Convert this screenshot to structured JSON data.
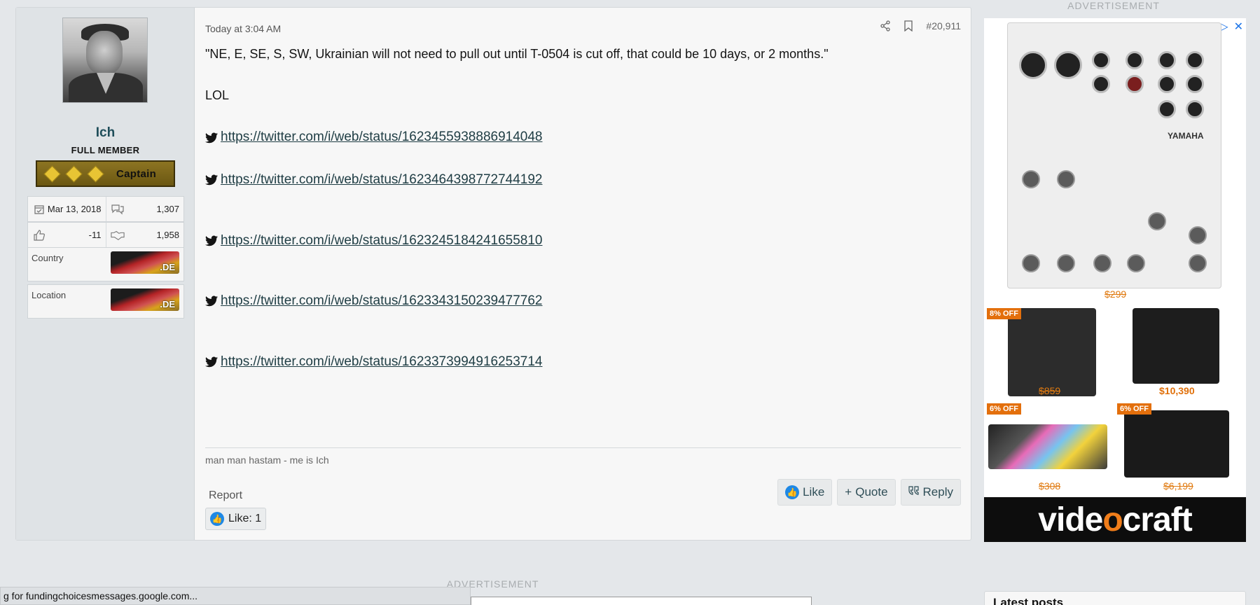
{
  "user": {
    "name": "Ich",
    "title": "FULL MEMBER",
    "rank": "Captain",
    "joined": "Mar 13, 2018",
    "messages": "1,307",
    "reaction_score": "-11",
    "points": "1,958",
    "country_label": "Country",
    "country_flag": ".DE",
    "location_label": "Location",
    "location_flag": ".DE"
  },
  "post": {
    "timestamp": "Today at 3:04 AM",
    "number": "#20,911",
    "quote": "\"NE, E, SE, S, SW, Ukrainian will not need to pull out until T-0504 is cut off, that could be 10 days, or 2 months.\"",
    "reply": "LOL",
    "links": [
      "https://twitter.com/i/web/status/1623455938886914048",
      "https://twitter.com/i/web/status/1623464398772744192",
      "https://twitter.com/i/web/status/1623245184241655810",
      "https://twitter.com/i/web/status/1623343150239477762",
      "https://twitter.com/i/web/status/1623373994916253714"
    ],
    "signature": "man man hastam - me is Ich",
    "report_label": "Report",
    "like_label": "Like",
    "quote_label": "Quote",
    "reply_label": "Reply",
    "likes_summary": "Like: 1"
  },
  "ads": {
    "label": "ADVERTISEMENT",
    "mixer_brand": "YAMAHA",
    "mixer_price": "$299",
    "recorder_badge": "8% OFF",
    "recorder_price": "$859",
    "camera_price": "$10,390",
    "keyboard_badge": "6% OFF",
    "keyboard_price": "$308",
    "sony_badge": "6% OFF",
    "sony_price": "$6,199",
    "brand": "videocraft",
    "brand_pre": "vide",
    "brand_o": "o",
    "brand_post": "craft"
  },
  "bottom": {
    "ad_label": "ADVERTISEMENT",
    "status_text": "g for fundingchoicesmessages.google.com...",
    "latest_posts": "Latest posts"
  },
  "colors": {
    "username": "#1f4e5a",
    "link": "#1f3d44",
    "accent_price": "#e07a10"
  }
}
